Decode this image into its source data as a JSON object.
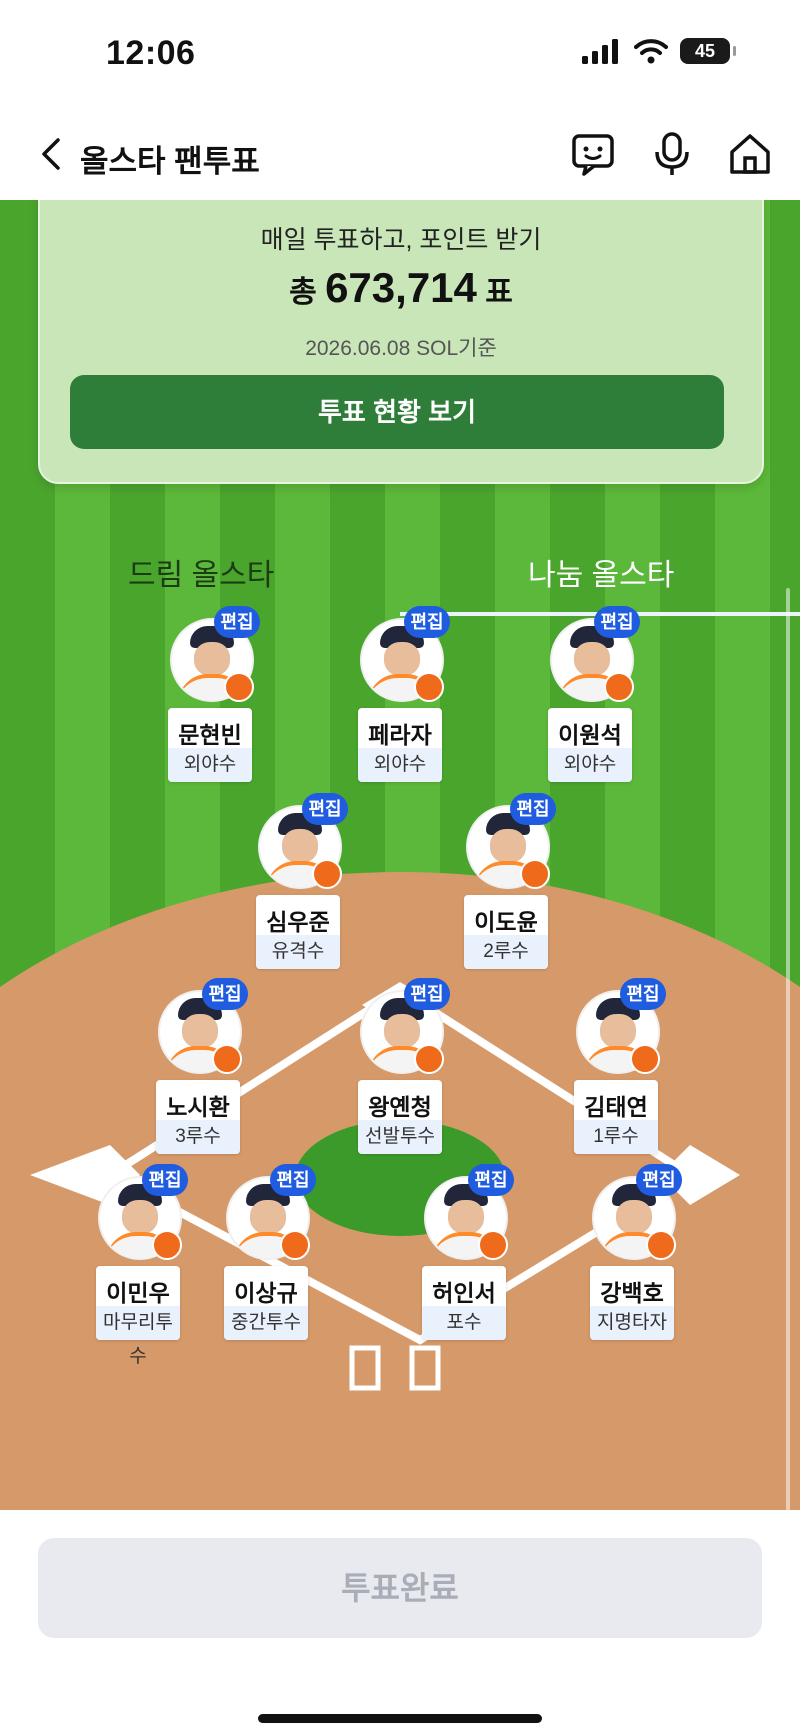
{
  "status_bar": {
    "time": "12:06",
    "battery": "45"
  },
  "nav": {
    "title": "올스타 팬투표",
    "icons": [
      "chevron-left-icon",
      "chatbot-icon",
      "microphone-icon",
      "home-icon"
    ]
  },
  "vote_card": {
    "subtitle": "매일 투표하고, 포인트 받기",
    "total_prefix": "총",
    "total_votes": "673,714",
    "total_suffix": "표",
    "date_note": "2026.06.08 SOL기준",
    "button_label": "투표 현황 보기"
  },
  "tabs": {
    "left": "드림 올스타",
    "right": "나눔 올스타",
    "selected": "나눔 올스타"
  },
  "edit_label": "편집",
  "players": [
    {
      "name": "문현빈",
      "position": "외야수"
    },
    {
      "name": "페라자",
      "position": "외야수"
    },
    {
      "name": "이원석",
      "position": "외야수"
    },
    {
      "name": "심우준",
      "position": "유격수"
    },
    {
      "name": "이도윤",
      "position": "2루수"
    },
    {
      "name": "노시환",
      "position": "3루수"
    },
    {
      "name": "왕옌청",
      "position": "선발투수"
    },
    {
      "name": "김태연",
      "position": "1루수"
    },
    {
      "name": "이민우",
      "position": "마무리투수"
    },
    {
      "name": "이상규",
      "position": "중간투수"
    },
    {
      "name": "허인서",
      "position": "포수"
    },
    {
      "name": "강백호",
      "position": "지명타자"
    }
  ],
  "submit": {
    "label": "투표완료",
    "state": "disabled"
  },
  "colors": {
    "field_green": "#4aa52d",
    "infield_dirt": "#d69a6a",
    "edit_blue": "#1f5ce0",
    "card_button": "#2e7d38"
  }
}
